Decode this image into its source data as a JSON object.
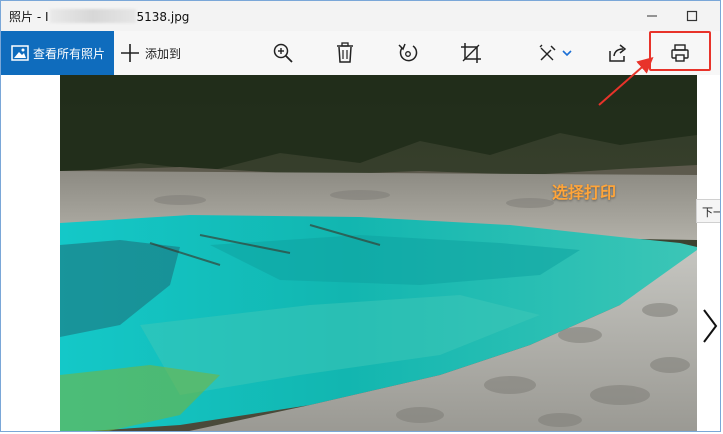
{
  "window": {
    "title_prefix": "照片 - I",
    "title_suffix": "5138.jpg"
  },
  "toolbar": {
    "all_photos_label": "查看所有照片",
    "add_to_label": "添加到"
  },
  "annotation": {
    "callout_text": "选择打印",
    "highlight_color": "#e8332a",
    "callout_color": "#ffa53a"
  },
  "next_tooltip": "下一",
  "icons": {
    "zoom": "zoom-in-icon",
    "delete": "trash-icon",
    "rotate": "rotate-icon",
    "crop": "crop-icon",
    "edit": "edit-create-icon",
    "share": "share-icon",
    "print": "printer-icon"
  },
  "colors": {
    "accent": "#0f6cbd"
  }
}
